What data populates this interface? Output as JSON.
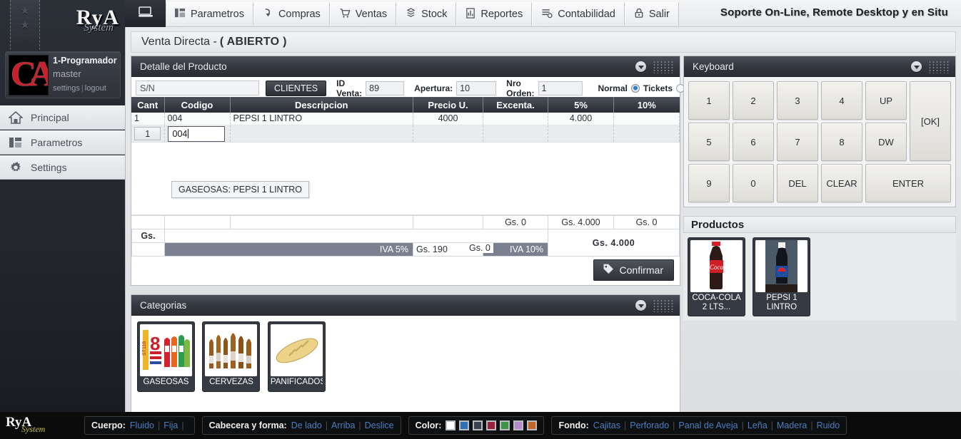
{
  "sidebar": {
    "logo": {
      "name": "RyA",
      "sub": "System"
    },
    "user": {
      "name": "1-Programador",
      "role": "master",
      "settings": "settings",
      "sep": "|",
      "logout": "logout",
      "avatar_text": "CA"
    },
    "items": [
      {
        "label": "Principal",
        "icon": "home-icon"
      },
      {
        "label": "Parametros",
        "icon": "panels-icon"
      },
      {
        "label": "Settings",
        "icon": "gear-icon"
      }
    ]
  },
  "topbar": {
    "home_icon": "monitor-icon",
    "menu": [
      {
        "label": "Parametros",
        "icon": "panels-icon"
      },
      {
        "label": "Compras",
        "icon": "arrow-down-icon"
      },
      {
        "label": "Ventas",
        "icon": "cart-icon"
      },
      {
        "label": "Stock",
        "icon": "stack-icon"
      },
      {
        "label": "Reportes",
        "icon": "report-icon"
      },
      {
        "label": "Contabilidad",
        "icon": "ledger-icon"
      },
      {
        "label": "Salir",
        "icon": "lock-icon"
      }
    ],
    "support": "Soporte On-Line, Remote Desktop y en Situ"
  },
  "page": {
    "title": "Venta Directa - ",
    "status": "( ABIERTO )"
  },
  "detalle": {
    "panel_title": "Detalle del Producto",
    "sn_value": "S/N",
    "clientes_button": "CLIENTES",
    "fields": [
      {
        "label": "ID Venta:",
        "value": "89"
      },
      {
        "label": "Apertura:",
        "value": "10"
      },
      {
        "label": "Nro Orden:",
        "value": "1"
      }
    ],
    "mode": {
      "normal_label": "Normal",
      "tickets_label": "Tickets",
      "selected": "Normal"
    },
    "columns": [
      "Cant",
      "Codigo",
      "Descripcion",
      "Precio U.",
      "Excenta.",
      "5%",
      "10%"
    ],
    "rows": [
      {
        "cant": "1",
        "codigo": "004",
        "descripcion": "PEPSI 1 LINTRO",
        "precio": "4000",
        "excenta": "",
        "iva5": "4.000",
        "iva10": ""
      }
    ],
    "edit_row": {
      "cant": "1",
      "codigo": "004"
    },
    "suggestion": "GASEOSAS: PEPSI 1 LINTRO",
    "subtotals": {
      "excenta": "Gs. 0",
      "iva5": "Gs. 4.000",
      "iva10": "Gs. 0"
    },
    "gs_label": "Gs.",
    "iva5_label": "IVA 5%",
    "iva5_value": "Gs. 190",
    "iva10_label": "IVA 10%",
    "iva10_value": "Gs. 0",
    "grand_total": "Gs. 4.000",
    "confirm_button": "Confirmar"
  },
  "categorias": {
    "panel_title": "Categorias",
    "items": [
      {
        "label": "GASEOSAS",
        "image": "soda-bottles-photo"
      },
      {
        "label": "CERVEZAS",
        "image": "beer-bottles-photo"
      },
      {
        "label": "PANIFICADOSs",
        "image": "bread-loaf-photo"
      }
    ]
  },
  "keyboard": {
    "panel_title": "Keyboard",
    "keys": [
      "1",
      "2",
      "3",
      "4",
      "UP",
      "[OK]",
      "5",
      "6",
      "7",
      "8",
      "DW",
      "9",
      "0",
      "DEL",
      "CLEAR",
      "ENTER"
    ]
  },
  "productos": {
    "panel_title": "Productos",
    "items": [
      {
        "label": "COCA-COLA 2 LTS...",
        "image": "coca-cola-bottle-photo"
      },
      {
        "label": "PEPSI 1 LINTRO",
        "image": "pepsi-bottle-photo"
      }
    ]
  },
  "bottombar": {
    "logo": {
      "name": "RyA",
      "sub": "System"
    },
    "cuerpo": {
      "label": "Cuerpo:",
      "options": [
        "Fluido",
        "Fija"
      ]
    },
    "cabecera": {
      "label": "Cabecera y forma:",
      "options": [
        "De lado",
        "Arriba",
        "Deslice"
      ]
    },
    "color": {
      "label": "Color:",
      "swatches": [
        "#ffffff",
        "#2f6fb5",
        "#39414e",
        "#9c1f3d",
        "#3e9447",
        "#b58ccb",
        "#c4652a"
      ]
    },
    "fondo": {
      "label": "Fondo:",
      "options": [
        "Cajitas",
        "Perforado",
        "Panal de Aveja",
        "Leña",
        "Madera",
        "Ruido"
      ]
    }
  }
}
